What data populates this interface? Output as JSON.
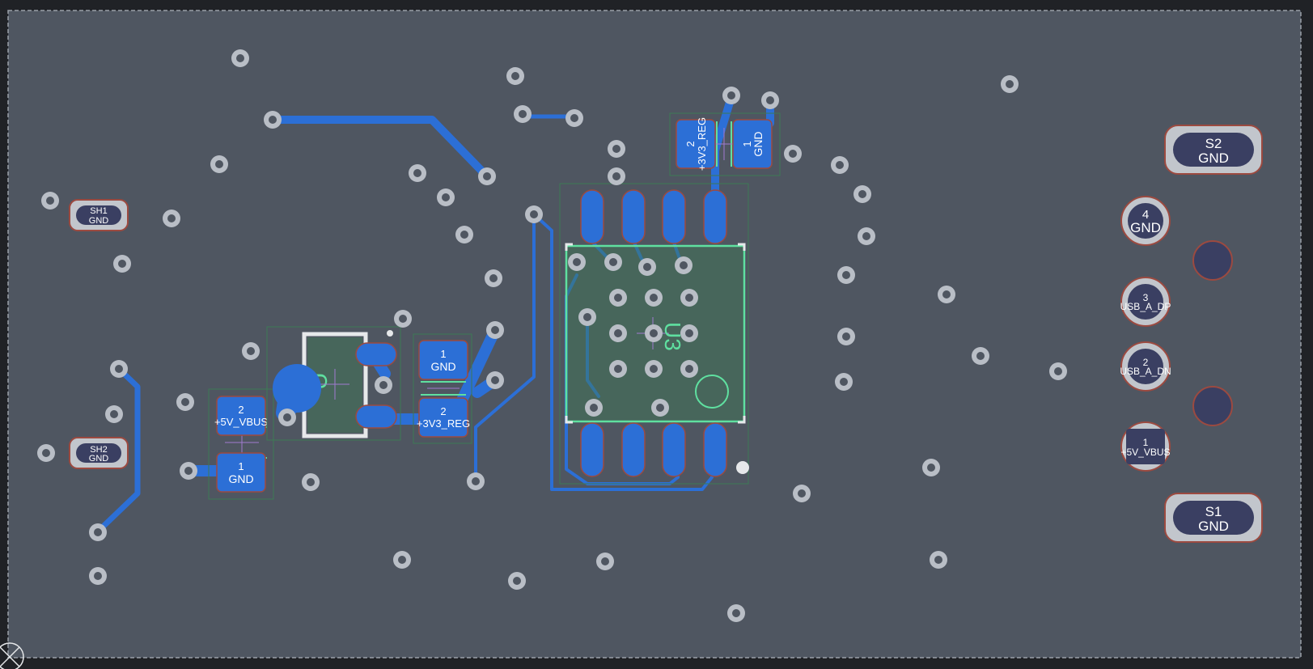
{
  "colors": {
    "background": "#202226",
    "board": "#4f5661",
    "board_edge": "#9aa0a8",
    "copper": "#2c6fd6",
    "pad_dark": "#3a3f62",
    "pad_outline": "#9c4a40",
    "via_ring": "#b9bec6",
    "silkscreen": "#5fe0a0",
    "courtyard": "#3d7a55",
    "label": "#ffffff"
  },
  "connector": {
    "pins": [
      {
        "number": "4",
        "net": "GND"
      },
      {
        "number": "3",
        "net": "USB_A_DP"
      },
      {
        "number": "2",
        "net": "USB_A_DN"
      },
      {
        "number": "1",
        "net": "+5V_VBUS"
      }
    ],
    "shield_pads": [
      {
        "name": "S2",
        "net": "GND"
      },
      {
        "name": "S1",
        "net": "GND"
      }
    ]
  },
  "shield_pads_left": [
    {
      "name": "SH1",
      "net": "GND"
    },
    {
      "name": "SH2",
      "net": "GND"
    }
  ],
  "cap_left": {
    "pad2": {
      "number": "2",
      "net": "+5V_VBUS"
    },
    "pad1": {
      "number": "1",
      "net": "GND"
    }
  },
  "cap_mid": {
    "pad1": {
      "number": "1",
      "net": "GND"
    },
    "pad2": {
      "number": "2",
      "net": "+3V3_REG"
    }
  },
  "cap_top": {
    "pad2": {
      "number": "2",
      "net": "+3V3_REG"
    },
    "pad1": {
      "number": "1",
      "net": "GND"
    }
  },
  "ic": {
    "refdes": "U3"
  },
  "regulator": {
    "refdes": "U"
  }
}
